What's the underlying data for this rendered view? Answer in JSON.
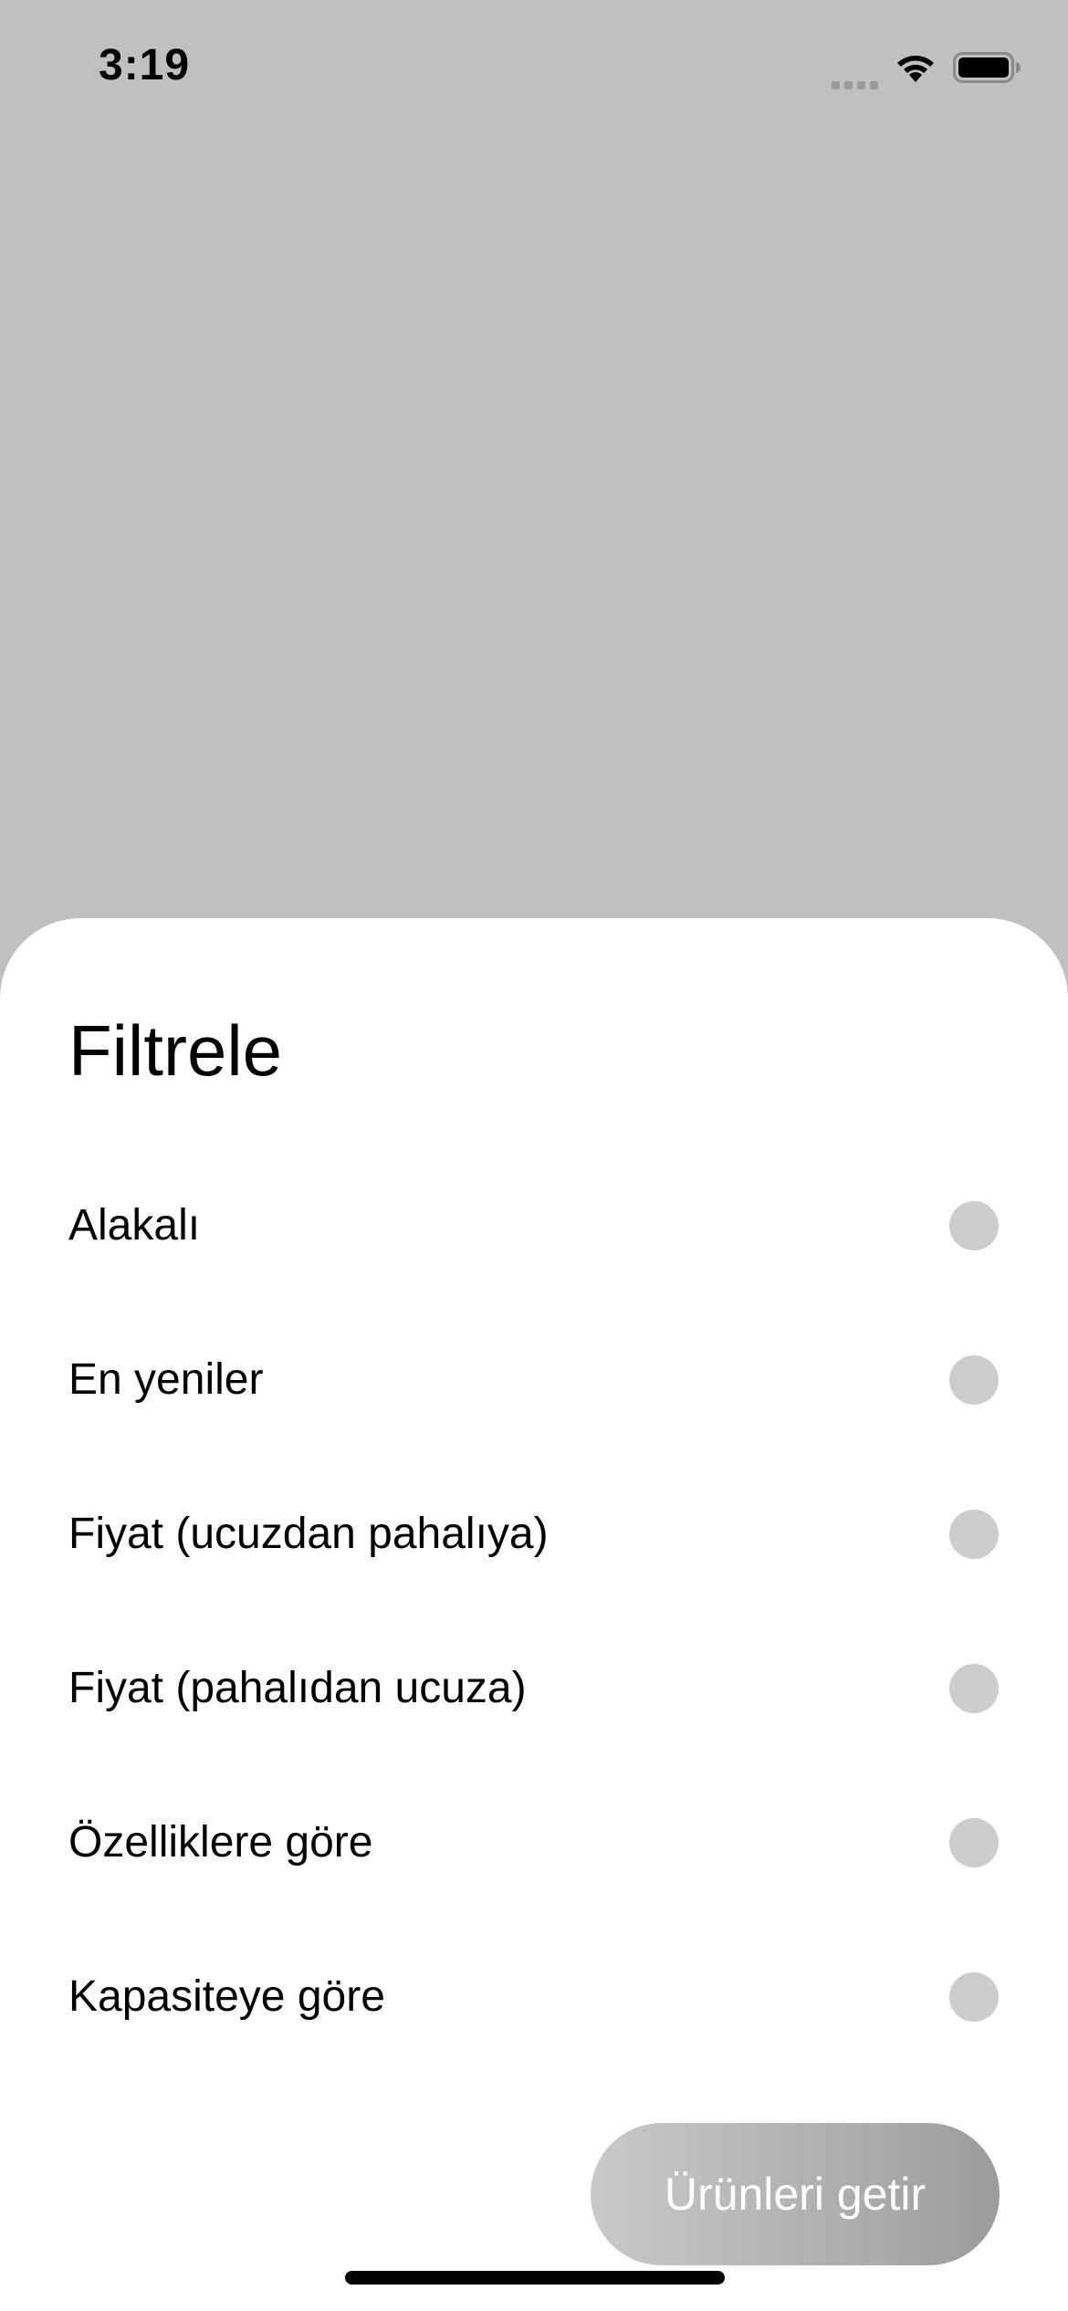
{
  "status_bar": {
    "time": "3:19",
    "icons": [
      "cellular-signal-icon",
      "wifi-icon",
      "battery-icon"
    ]
  },
  "sheet": {
    "title": "Filtrele",
    "options": [
      {
        "label": "Alakalı",
        "selected": false
      },
      {
        "label": "En yeniler",
        "selected": false
      },
      {
        "label": "Fiyat (ucuzdan pahalıya)",
        "selected": false
      },
      {
        "label": "Fiyat (pahalıdan ucuza)",
        "selected": false
      },
      {
        "label": "Özelliklere göre",
        "selected": false
      },
      {
        "label": "Kapasiteye göre",
        "selected": false
      }
    ],
    "submit_label": "Ürünleri getir"
  },
  "colors": {
    "backdrop": "#c0c0c0",
    "sheet_background": "#ffffff",
    "radio_unselected": "#cdcdcd",
    "button_gradient_start": "#c9c9c9",
    "button_gradient_end": "#9c9c9c",
    "button_text": "#ffffff"
  }
}
